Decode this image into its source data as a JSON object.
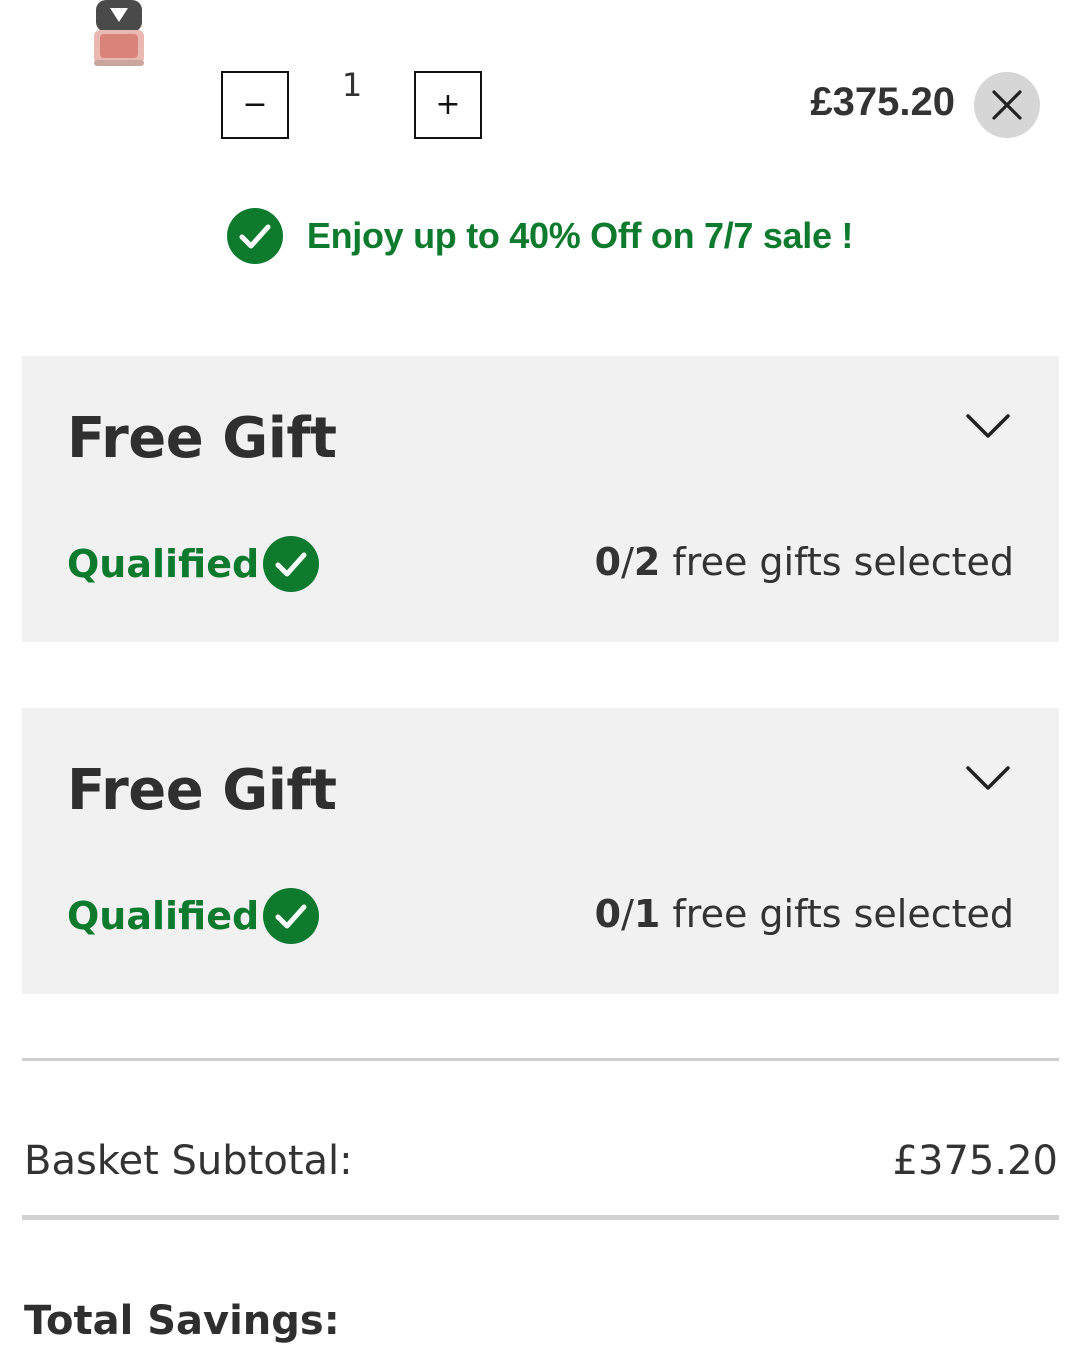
{
  "cart_item": {
    "quantity": "1",
    "decrease_glyph": "−",
    "increase_glyph": "+",
    "price": "£375.20"
  },
  "promo": {
    "text": "Enjoy up to 40% Off on 7/7 sale !",
    "color": "#0d7a2d"
  },
  "free_gifts": [
    {
      "title": "Free Gift",
      "status": "Qualified",
      "selected": "0",
      "total": "2",
      "suffix": "free gifts selected"
    },
    {
      "title": "Free Gift",
      "status": "Qualified",
      "selected": "0",
      "total": "1",
      "suffix": "free gifts selected"
    }
  ],
  "summary": {
    "subtotal_label": "Basket Subtotal:",
    "subtotal_value": "£375.20",
    "savings_label": "Total Savings:"
  },
  "icons": {
    "remove": "close-icon",
    "check": "check-circle-icon",
    "expand": "chevron-down-icon"
  },
  "colors": {
    "accent_green": "#0d7a2d",
    "panel_bg": "#f1f1f1"
  }
}
